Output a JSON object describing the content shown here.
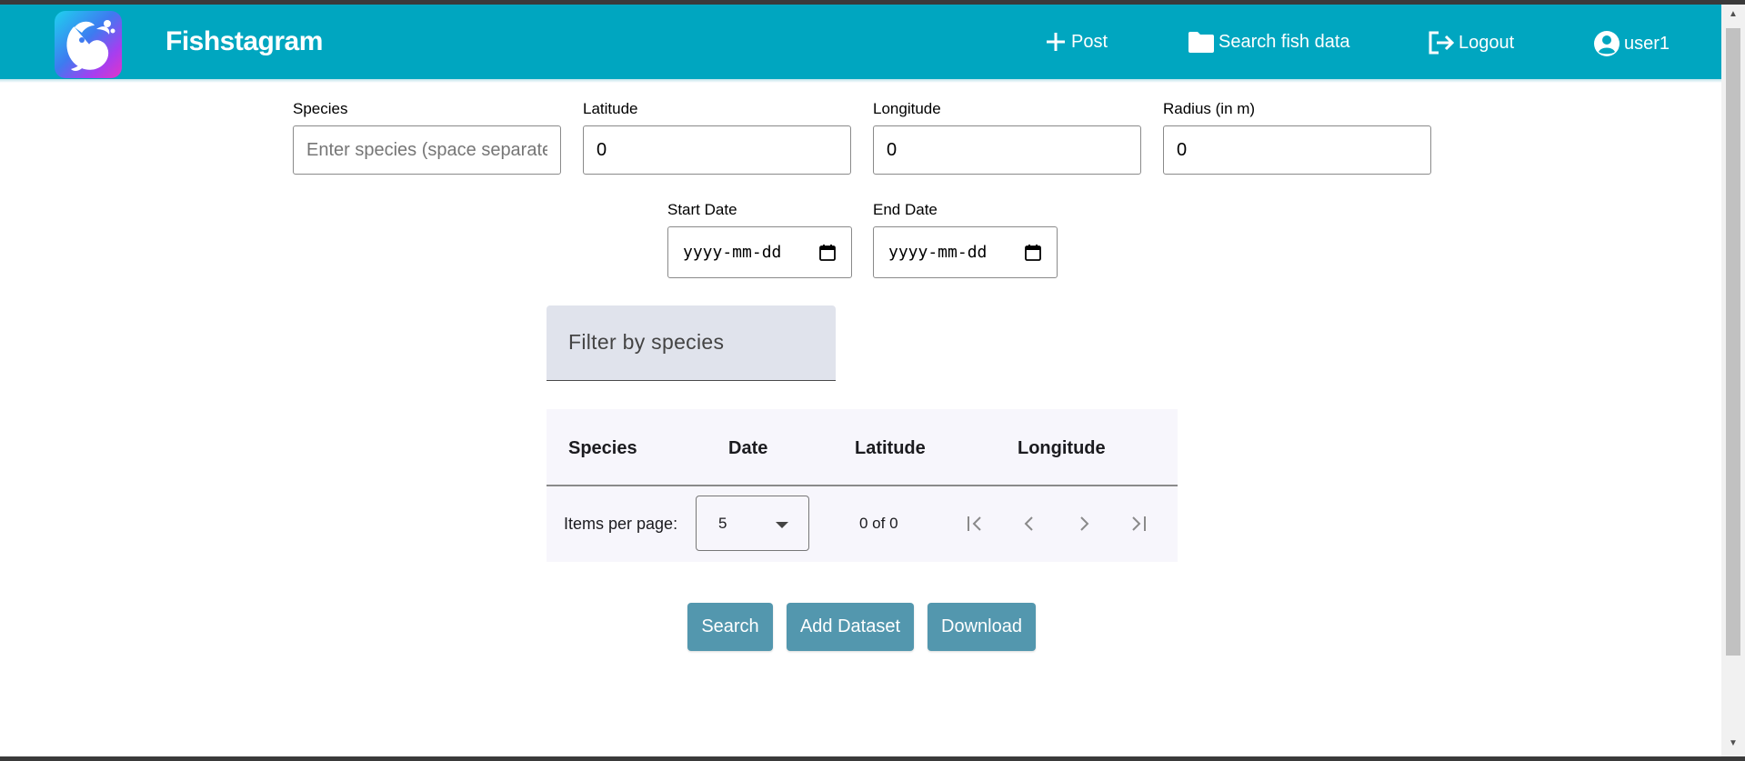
{
  "header": {
    "brand": "Fishstagram",
    "nav": {
      "post": "Post",
      "search_fish_data": "Search fish data",
      "logout": "Logout",
      "user": "user1"
    }
  },
  "form": {
    "species": {
      "label": "Species",
      "placeholder": "Enter species (space separated)",
      "value": ""
    },
    "latitude": {
      "label": "Latitude",
      "value": "0"
    },
    "longitude": {
      "label": "Longitude",
      "value": "0"
    },
    "radius": {
      "label": "Radius (in m)",
      "value": "0"
    },
    "start_date": {
      "label": "Start Date",
      "placeholder": "yyyy-mm-dd"
    },
    "end_date": {
      "label": "End Date",
      "placeholder": "yyyy-mm-dd"
    }
  },
  "filter": {
    "label": "Filter by species"
  },
  "table": {
    "columns": [
      "Species",
      "Date",
      "Latitude",
      "Longitude"
    ],
    "rows": []
  },
  "paginator": {
    "items_per_page_label": "Items per page:",
    "items_per_page_value": "5",
    "range_label": "0 of 0"
  },
  "actions": {
    "search": "Search",
    "add_dataset": "Add Dataset",
    "download": "Download"
  },
  "colors": {
    "navbar": "#00a6c0",
    "button": "#5397ae",
    "filter_background": "#e0e3ec",
    "table_background": "#f7f6fc"
  }
}
